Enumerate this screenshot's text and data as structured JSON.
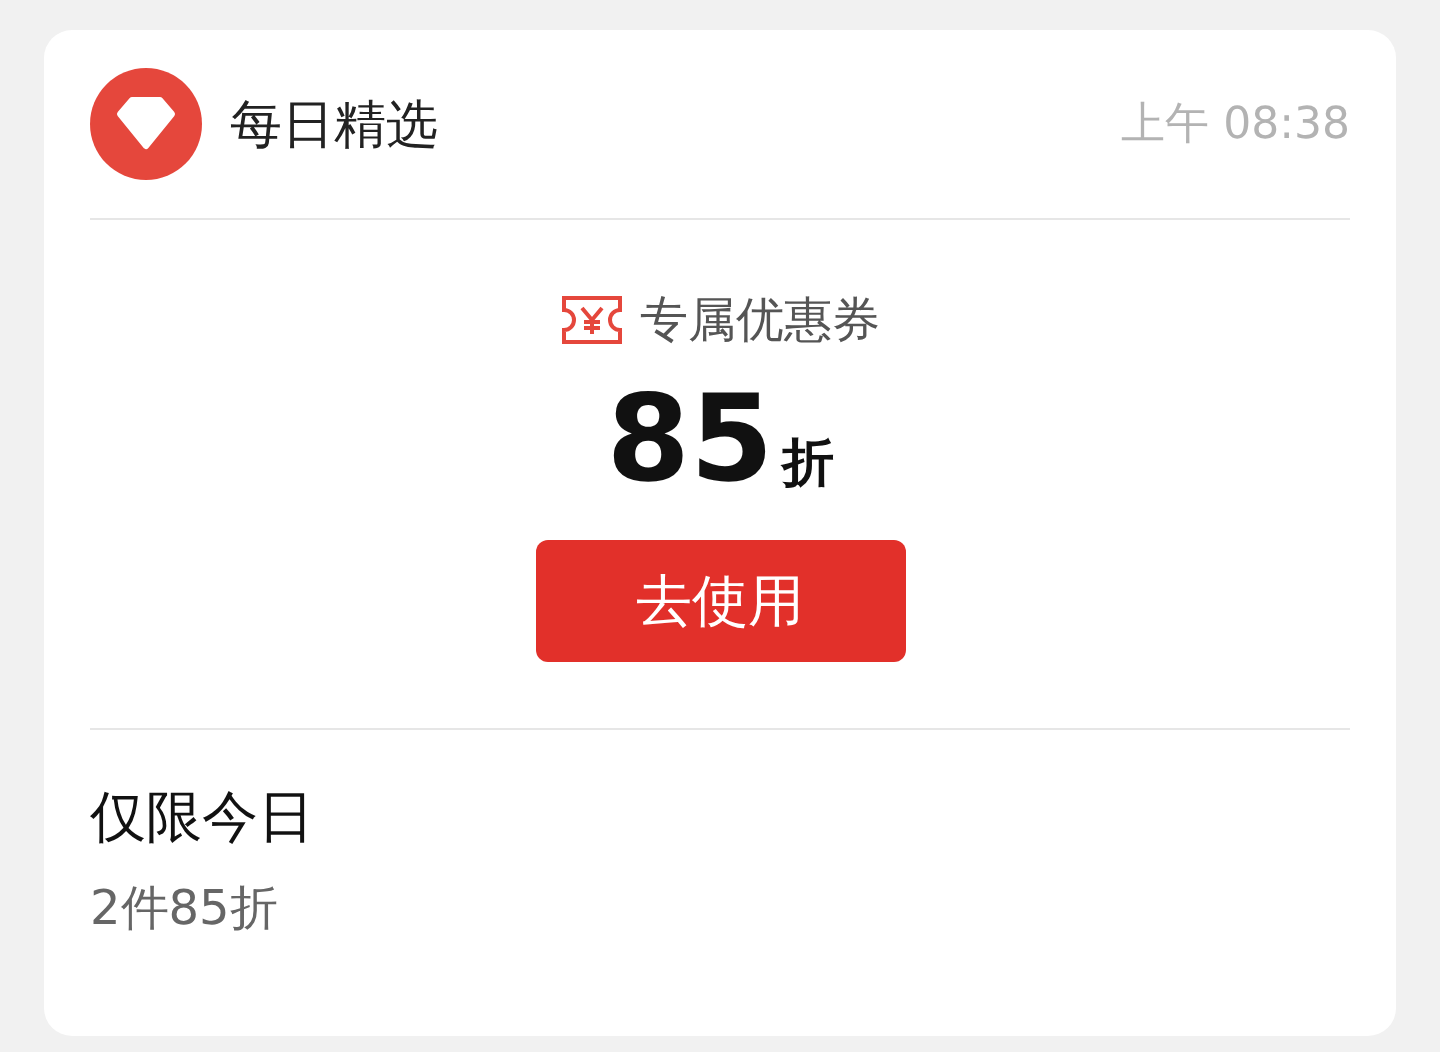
{
  "header": {
    "title": "每日精选",
    "time": "上午 08:38"
  },
  "coupon": {
    "label": "专属优惠券",
    "amount": "85",
    "unit": "折",
    "button": "去使用"
  },
  "footer": {
    "title": "仅限今日",
    "subtitle": "2件85折"
  }
}
